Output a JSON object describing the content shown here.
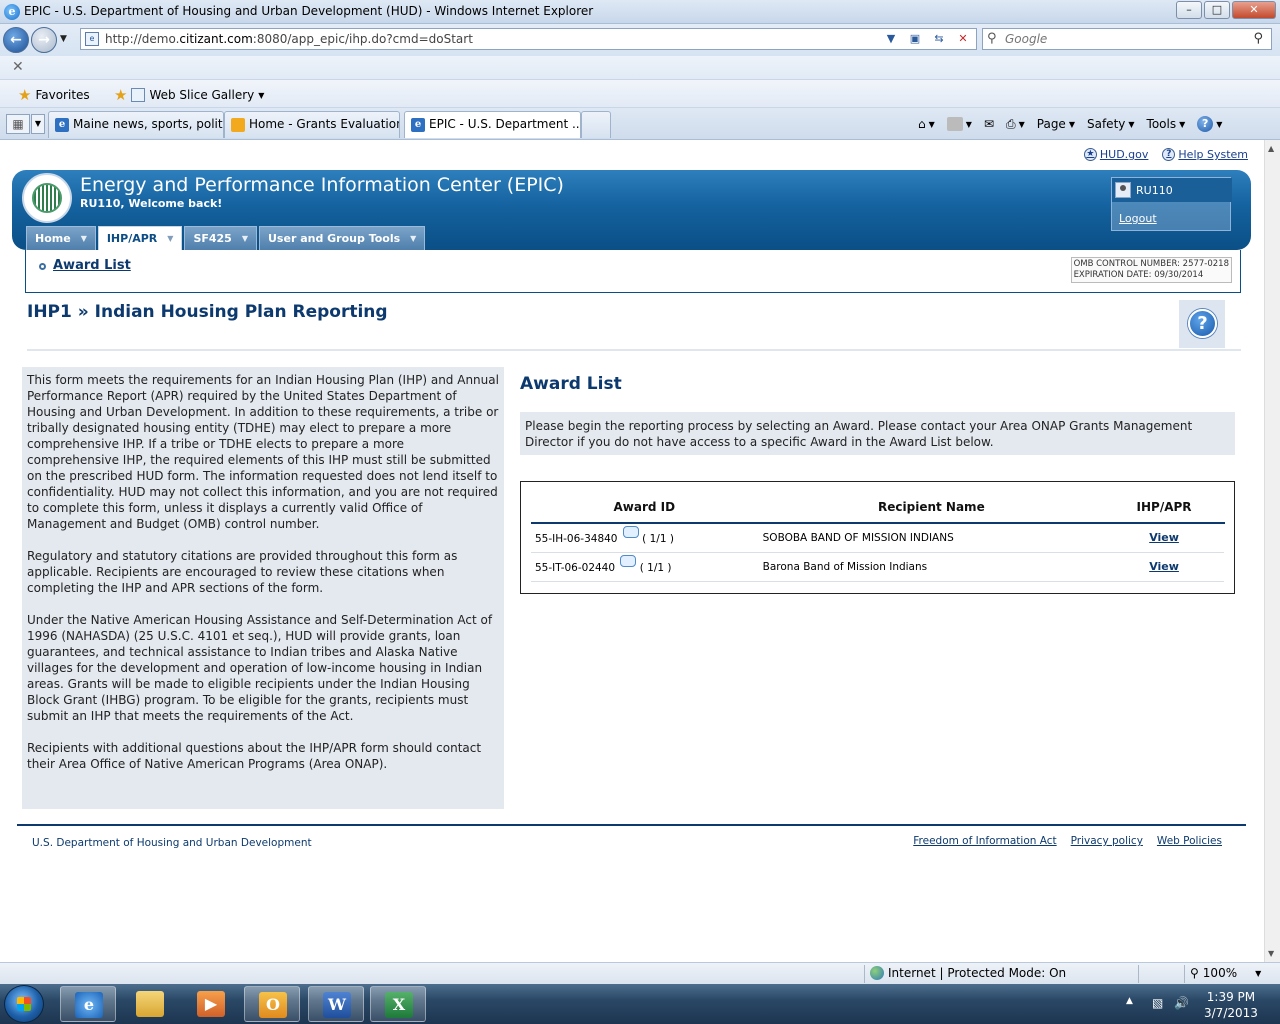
{
  "window": {
    "title": "EPIC - U.S. Department of Housing and Urban Development (HUD) - Windows Internet Explorer",
    "minimize": "–",
    "maximize": "□",
    "close": "✕"
  },
  "address_bar": {
    "url_prefix": "http://demo.",
    "url_domain": "citizant.com",
    "url_suffix": ":8080/app_epic/ihp.do?cmd=doStart",
    "search_placeholder": "Google"
  },
  "favorites_bar": {
    "favorites_label": "Favorites",
    "web_slice_label": "Web Slice Gallery"
  },
  "tabs": [
    {
      "label": "Maine news, sports, politic..."
    },
    {
      "label": "Home - Grants Evaluation"
    },
    {
      "label": "EPIC - U.S. Department ..."
    }
  ],
  "command_bar": {
    "page": "Page",
    "safety": "Safety",
    "tools": "Tools"
  },
  "util_links": {
    "hud": "HUD.gov",
    "help": "Help System"
  },
  "header": {
    "app_title": "Energy and Performance Information Center (EPIC)",
    "welcome": "RU110, Welcome back!",
    "username": "RU110",
    "logout": "Logout"
  },
  "menu": [
    {
      "label": "Home"
    },
    {
      "label": "IHP/APR"
    },
    {
      "label": "SF425"
    },
    {
      "label": "User and Group Tools"
    }
  ],
  "submenu": {
    "award_list_link": "Award List",
    "omb_line1": "OMB CONTROL NUMBER: 2577-0218",
    "omb_line2": "EXPIRATION DATE: 09/30/2014"
  },
  "page": {
    "title": "IHP1 » Indian Housing Plan Reporting",
    "info_paragraphs": [
      "This form meets the requirements for an Indian Housing Plan (IHP) and Annual Performance Report (APR) required by the United States Department of Housing and Urban Development. In addition to these requirements, a tribe or tribally designated housing entity (TDHE) may elect to prepare a more comprehensive IHP. If a tribe or TDHE elects to prepare a more comprehensive IHP, the required elements of this IHP must still be submitted on the prescribed HUD form. The information requested does not lend itself to confidentiality. HUD may not collect this information, and you are not required to complete this form, unless it displays a currently valid Office of Management and Budget (OMB) control number.",
      "Regulatory and statutory citations are provided throughout this form as applicable. Recipients are encouraged to review these citations when completing the IHP and APR sections of the form.",
      "Under the Native American Housing Assistance and Self-Determination Act of 1996 (NAHASDA) (25 U.S.C. 4101 et seq.), HUD will provide grants, loan guarantees, and technical assistance to Indian tribes and Alaska Native villages for the development and operation of low-income housing in Indian areas. Grants will be made to eligible recipients under the Indian Housing Block Grant (IHBG) program. To be eligible for the grants, recipients must submit an IHP that meets the requirements of the Act.",
      "Recipients with additional questions about the IHP/APR form should contact their Area Office of Native American Programs (Area ONAP)."
    ],
    "list_heading": "Award List",
    "instructions": "Please begin the reporting process by selecting an Award. Please contact your Area ONAP Grants Management Director if you do not have access to a specific Award in the Award List below."
  },
  "award_table": {
    "headers": [
      "Award ID",
      "Recipient Name",
      "IHP/APR"
    ],
    "rows": [
      {
        "award_id": "55-IH-06-34840",
        "count": "( 1/1 )",
        "recipient": "SOBOBA BAND OF MISSION INDIANS",
        "action": "View"
      },
      {
        "award_id": "55-IT-06-02440",
        "count": "( 1/1 )",
        "recipient": "Barona Band of Mission Indians",
        "action": "View"
      }
    ]
  },
  "footer": {
    "org": "U.S. Department of Housing and Urban Development",
    "links": [
      "Freedom of Information Act",
      "Privacy policy",
      "Web Policies"
    ]
  },
  "status_bar": {
    "zone": "Internet | Protected Mode: On",
    "zoom": "100%"
  },
  "taskbar": {
    "time": "1:39 PM",
    "date": "3/7/2013"
  },
  "colors": {
    "brand_blue": "#0d3a6e",
    "banner_blue": "#14629f",
    "panel_gray": "#e4e9f0"
  }
}
